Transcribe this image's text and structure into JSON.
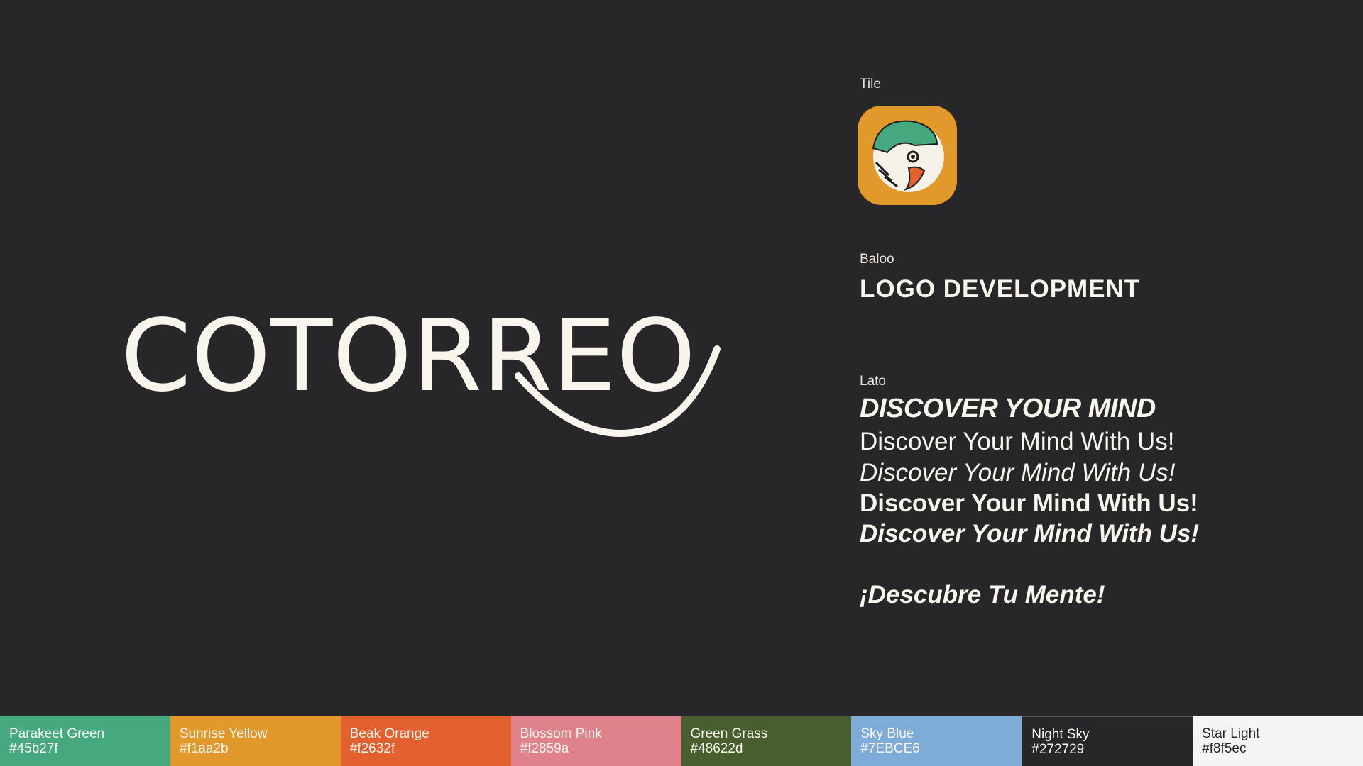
{
  "logo": {
    "wordmark": "COTORREO"
  },
  "sections": {
    "tile_label": "Tile",
    "baloo_label": "Baloo",
    "baloo_sample": "LOGO DEVELOPMENT",
    "lato_label": "Lato",
    "lato_samples": [
      "DISCOVER YOUR MIND",
      "Discover Your Mind With Us!",
      "Discover Your Mind With Us!",
      "Discover Your Mind With Us!",
      "Discover Your Mind With Us!",
      "¡Descubre Tu Mente!"
    ]
  },
  "tile_icon": "parrot-icon",
  "palette": [
    {
      "name": "Parakeet Green",
      "hex": "#45b27f",
      "color": "#45a87e"
    },
    {
      "name": "Sunrise Yellow",
      "hex": "#f1aa2b",
      "color": "#e2992b"
    },
    {
      "name": "Beak Orange",
      "hex": "#f2632f",
      "color": "#e2612f"
    },
    {
      "name": "Blossom Pink",
      "hex": "#f2859a",
      "color": "#e0828c"
    },
    {
      "name": "Green Grass",
      "hex": "#48622d",
      "color": "#485e2e"
    },
    {
      "name": "Sky Blue",
      "hex": "#7EBCE6",
      "color": "#7eacd8"
    },
    {
      "name": "Night Sky",
      "hex": "#272729",
      "color": "#272729"
    },
    {
      "name": "Star Light",
      "hex": "#f8f5ec",
      "color": "#f5f5f5"
    }
  ]
}
